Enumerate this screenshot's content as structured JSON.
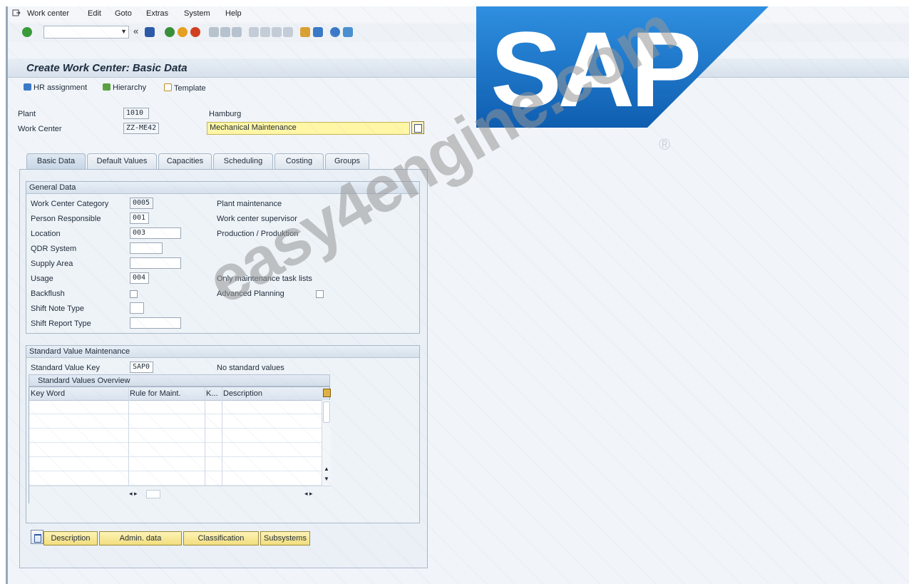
{
  "menu": {
    "items": [
      "Work center",
      "Edit",
      "Goto",
      "Extras",
      "System",
      "Help"
    ]
  },
  "toolbar": {
    "command_field_value": ""
  },
  "title": "Create Work Center: Basic Data",
  "app_toolbar": {
    "hr_assignment": "HR assignment",
    "hierarchy": "Hierarchy",
    "template": "Template"
  },
  "header": {
    "plant_label": "Plant",
    "plant_value": "1010",
    "plant_name": "Hamburg",
    "work_center_label": "Work Center",
    "work_center_value": "ZZ-ME42",
    "work_center_desc": "Mechanical Maintenance"
  },
  "tabs": [
    "Basic Data",
    "Default Values",
    "Capacities",
    "Scheduling",
    "Costing",
    "Groups"
  ],
  "general_data": {
    "title": "General Data",
    "work_center_category_label": "Work Center Category",
    "work_center_category_value": "0005",
    "work_center_category_text": "Plant maintenance",
    "person_responsible_label": "Person Responsible",
    "person_responsible_value": "001",
    "person_responsible_text": "Work center supervisor",
    "location_label": "Location",
    "location_value": "003",
    "location_text": "Production / Produktion",
    "qdr_system_label": "QDR System",
    "qdr_system_value": "",
    "supply_area_label": "Supply Area",
    "supply_area_value": "",
    "usage_label": "Usage",
    "usage_value": "004",
    "usage_text": "Only maintenance task lists",
    "backflush_label": "Backflush",
    "advanced_planning_label": "Advanced Planning",
    "shift_note_type_label": "Shift Note Type",
    "shift_note_type_value": "",
    "shift_report_type_label": "Shift Report Type",
    "shift_report_type_value": ""
  },
  "standard_value_maintenance": {
    "title": "Standard Value Maintenance",
    "key_label": "Standard Value Key",
    "key_value": "SAP0",
    "key_text": "No standard values",
    "overview_title": "Standard Values Overview",
    "columns": [
      "Key Word",
      "Rule for Maint.",
      "K...",
      "Description"
    ]
  },
  "bottom_buttons": [
    "Description",
    "Admin. data",
    "Classification",
    "Subsystems"
  ],
  "logo": {
    "text": "SAP",
    "registered": "®",
    "color": "#1a73c9"
  },
  "watermark": "easy4engine.com"
}
